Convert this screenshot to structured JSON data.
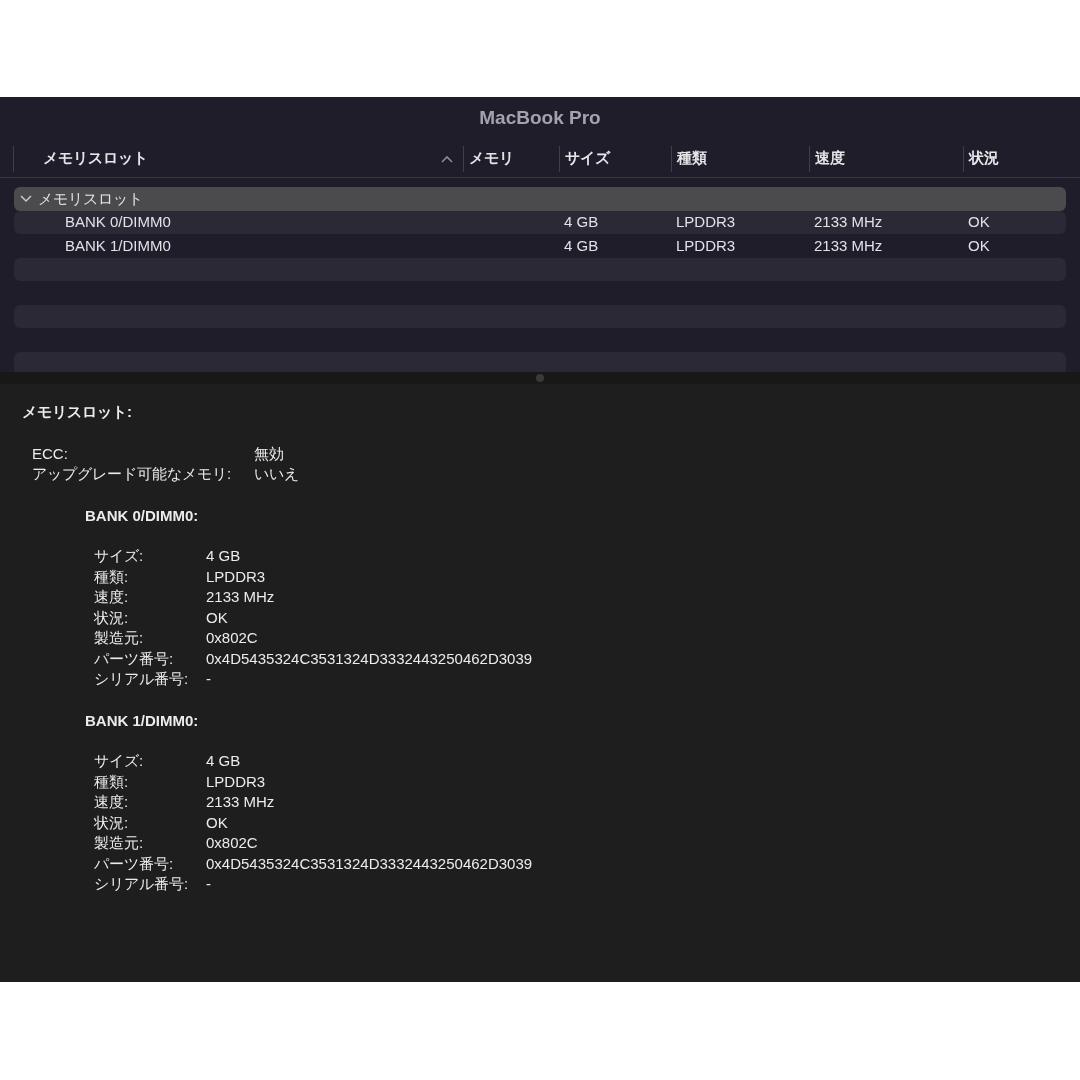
{
  "window": {
    "title": "MacBook Pro"
  },
  "table": {
    "columns": [
      {
        "label": "メモリスロット",
        "sorted": true
      },
      {
        "label": "メモリ",
        "sorted": false
      },
      {
        "label": "サイズ",
        "sorted": false
      },
      {
        "label": "種類",
        "sorted": false
      },
      {
        "label": "速度",
        "sorted": false
      },
      {
        "label": "状況",
        "sorted": false
      }
    ],
    "rows": [
      {
        "name": "メモリスロット",
        "selected": true,
        "expanded": true,
        "children": [
          {
            "name": "BANK 0/DIMM0",
            "selected": false,
            "cells": [
              "",
              "4 GB",
              "LPDDR3",
              "2133 MHz",
              "OK"
            ]
          },
          {
            "name": "BANK 1/DIMM0",
            "selected": false,
            "cells": [
              "",
              "4 GB",
              "LPDDR3",
              "2133 MHz",
              "OK"
            ]
          }
        ]
      }
    ]
  },
  "detail": {
    "heading": "メモリスロット:",
    "fields": [
      {
        "label": "ECC:",
        "value": "無効"
      },
      {
        "label": "アップグレード可能なメモリ:",
        "value": "いいえ"
      }
    ],
    "banks": [
      {
        "title": "BANK 0/DIMM0:",
        "fields": [
          {
            "label": "サイズ:",
            "value": "4 GB"
          },
          {
            "label": "種類:",
            "value": "LPDDR3"
          },
          {
            "label": "速度:",
            "value": "2133 MHz"
          },
          {
            "label": "状況:",
            "value": "OK"
          },
          {
            "label": "製造元:",
            "value": "0x802C"
          },
          {
            "label": "パーツ番号:",
            "value": "0x4D5435324C3531324D3332443250462D3039"
          },
          {
            "label": "シリアル番号:",
            "value": "-"
          }
        ]
      },
      {
        "title": "BANK 1/DIMM0:",
        "fields": [
          {
            "label": "サイズ:",
            "value": "4 GB"
          },
          {
            "label": "種類:",
            "value": "LPDDR3"
          },
          {
            "label": "速度:",
            "value": "2133 MHz"
          },
          {
            "label": "状況:",
            "value": "OK"
          },
          {
            "label": "製造元:",
            "value": "0x802C"
          },
          {
            "label": "パーツ番号:",
            "value": "0x4D5435324C3531324D3332443250462D3039"
          },
          {
            "label": "シリアル番号:",
            "value": "-"
          }
        ]
      }
    ]
  }
}
